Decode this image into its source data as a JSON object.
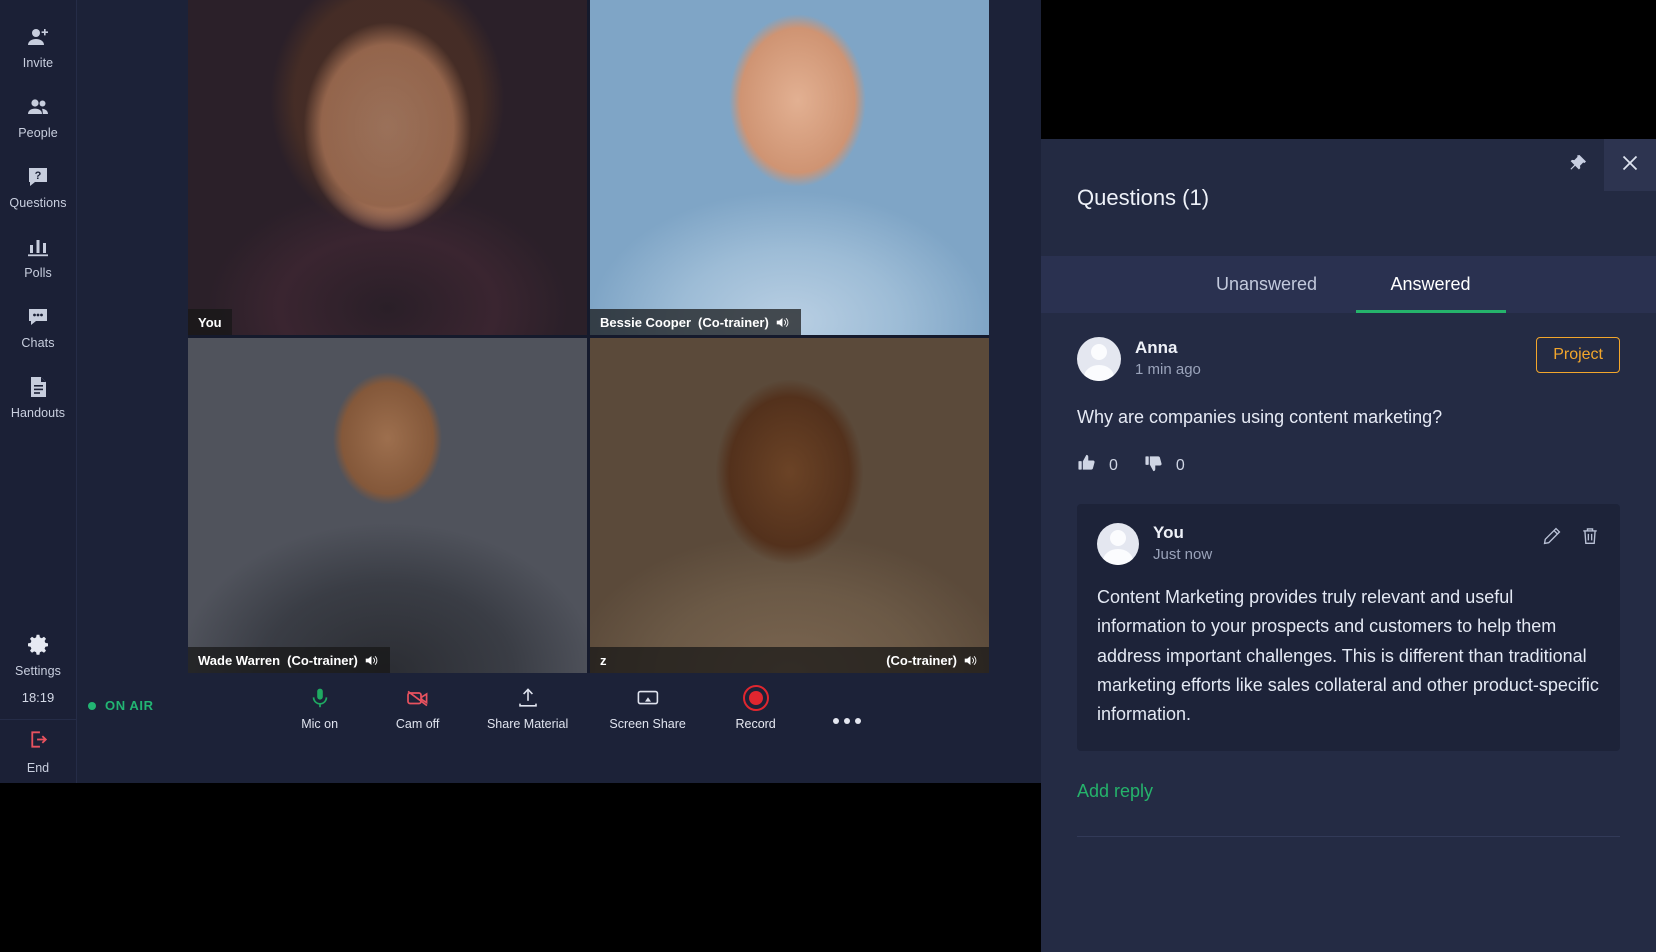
{
  "sidebar": {
    "items": [
      {
        "label": "Invite",
        "icon": "person-add-icon"
      },
      {
        "label": "People",
        "icon": "people-icon"
      },
      {
        "label": "Questions",
        "icon": "question-box-icon"
      },
      {
        "label": "Polls",
        "icon": "bar-chart-icon"
      },
      {
        "label": "Chats",
        "icon": "chat-bubble-icon"
      },
      {
        "label": "Handouts",
        "icon": "document-icon"
      }
    ],
    "settings": {
      "label": "Settings",
      "icon": "gear-icon"
    },
    "clock": "18:19",
    "end": {
      "label": "End",
      "icon": "exit-icon",
      "color": "#e8525f"
    }
  },
  "video": {
    "tiles": [
      {
        "name": "You",
        "suffix": "",
        "muted_icon": false
      },
      {
        "name": "Bessie Cooper",
        "suffix": "(Co-trainer)",
        "muted_icon": true
      },
      {
        "name": "Wade Warren",
        "suffix": "(Co-trainer)",
        "muted_icon": true
      },
      {
        "name": "z",
        "suffix": "(Co-trainer)",
        "muted_icon": true
      }
    ]
  },
  "controls": {
    "on_air": "ON AIR",
    "on_air_color": "#22b573",
    "buttons": [
      {
        "label": "Mic on",
        "icon": "microphone-icon",
        "color": "#1faa62"
      },
      {
        "label": "Cam off",
        "icon": "camera-off-icon",
        "color": "#e8525f"
      },
      {
        "label": "Share Material",
        "icon": "share-material-icon",
        "color": "#dfe3ee"
      },
      {
        "label": "Screen Share",
        "icon": "screen-share-icon",
        "color": "#dfe3ee"
      },
      {
        "label": "Record",
        "icon": "record-icon",
        "color": "#e0262f"
      }
    ],
    "more": "more-options-icon"
  },
  "panel": {
    "title": "Questions (1)",
    "pin_icon": "pin-icon",
    "close_icon": "close-icon",
    "tabs": [
      {
        "label": "Unanswered",
        "active": false
      },
      {
        "label": "Answered",
        "active": true
      }
    ],
    "accent": "#25b36b",
    "question": {
      "author": "Anna",
      "time": "1 min ago",
      "badge": "Project",
      "badge_color": "#f2a62c",
      "text": "Why are companies using content marketing?",
      "upvotes": "0",
      "downvotes": "0",
      "thumbs_up_icon": "thumbs-up-icon",
      "thumbs_down_icon": "thumbs-down-icon"
    },
    "reply": {
      "author": "You",
      "time": "Just now",
      "edit_icon": "pencil-icon",
      "delete_icon": "trash-icon",
      "text": "Content Marketing provides truly relevant and useful information to your prospects and customers to help them address important challenges. This is different than traditional marketing efforts like sales collateral and other product-specific information."
    },
    "add_reply": "Add reply"
  }
}
